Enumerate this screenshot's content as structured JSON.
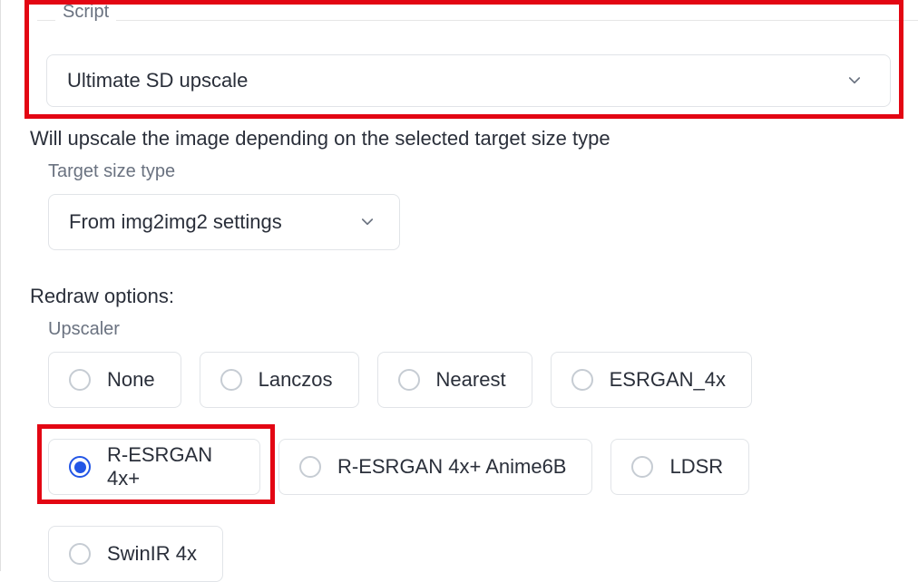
{
  "script": {
    "legend": "Script",
    "selected": "Ultimate SD upscale"
  },
  "description": "Will upscale the image depending on the selected target size type",
  "target_size_type": {
    "label": "Target size type",
    "selected": "From img2img2 settings"
  },
  "redraw": {
    "label": "Redraw options:",
    "upscaler_label": "Upscaler",
    "options": {
      "none": "None",
      "lanczos": "Lanczos",
      "nearest": "Nearest",
      "esrgan4x": "ESRGAN_4x",
      "resrgan4x": "R-ESRGAN 4x+",
      "resrgan4xanime": "R-ESRGAN 4x+ Anime6B",
      "ldsr": "LDSR",
      "swinir4x": "SwinIR 4x"
    },
    "selected": "resrgan4x"
  }
}
